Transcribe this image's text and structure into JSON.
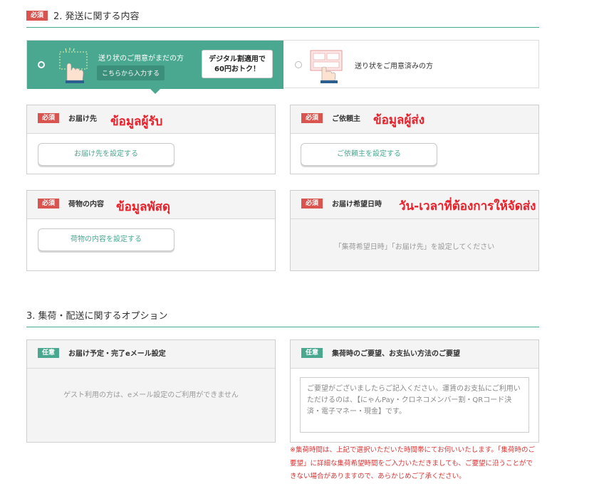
{
  "section2": {
    "badge": "必須",
    "title": "2. 発送に関する内容"
  },
  "method": {
    "option1": {
      "label": "送り状のご用意がまだの方",
      "chip": "こちらから入力する",
      "promo_line1": "デジタル割適用で",
      "promo_line2": "60円おトク！",
      "selected": true
    },
    "option2": {
      "label": "送り状をご用意済みの方",
      "selected": false
    }
  },
  "cards": {
    "recipient": {
      "badge": "必須",
      "label": "お届け先",
      "annotation": "ข้อมูลผู้รับ",
      "button": "お届け先を設定する"
    },
    "sender": {
      "badge": "必須",
      "label": "ご依頼主",
      "annotation": "ข้อมูลผู้ส่ง",
      "button": "ご依頼主を設定する"
    },
    "package": {
      "badge": "必須",
      "label": "荷物の内容",
      "annotation": "ข้อมูลพัสดุ",
      "button": "荷物の内容を設定する"
    },
    "delivery_time": {
      "badge": "必須",
      "label": "お届け希望日時",
      "annotation": "วัน-เวลาที่ต้องการให้จัดส่ง",
      "message": "「集荷希望日時」「お届け先」を設定してください"
    }
  },
  "section3": {
    "title": "3. 集荷・配送に関するオプション"
  },
  "options": {
    "email": {
      "badge": "任意",
      "label": "お届け予定・完了eメール設定",
      "message": "ゲスト利用の方は、eメール設定のご利用ができません"
    },
    "pickup": {
      "badge": "任意",
      "label": "集荷時のご要望、お支払い方法のご要望",
      "placeholder": "ご要望がございましたらご記入ください。運賃のお支払にご利用いただけるのは、【にゃんPay・クロネコメンバー割・QRコード決済・電子マネー・現金】です。"
    },
    "note": "※集荷時間は、上記で選択いただいた時間帯にてお伺いいたします。「集荷時のご要望」に詳細な集荷希望時間をご入力いただきましても、ご要望に沿うことができない場合がありますので、あらかじめご了承ください。"
  },
  "colors": {
    "accent": "#4aa891",
    "required": "#d9534f",
    "annotation": "#e8202a"
  }
}
